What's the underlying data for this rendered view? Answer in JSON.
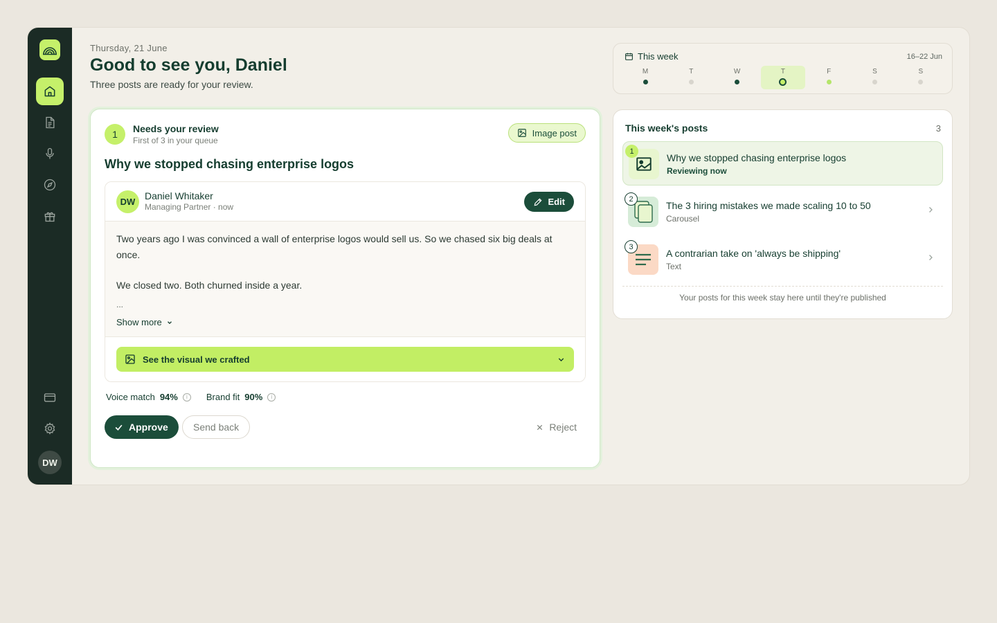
{
  "header": {
    "date": "Thursday, 21 June",
    "greeting": "Good to see you, Daniel",
    "subtitle": "Three posts are ready for your review."
  },
  "sidebar": {
    "user_initials": "DW",
    "nav": [
      "home-icon",
      "document-icon",
      "microphone-icon",
      "compass-icon",
      "gift-icon",
      "credit-card-icon",
      "gear-icon"
    ]
  },
  "week": {
    "title": "This week",
    "range": "16–22 Jun",
    "days": [
      {
        "letter": "M",
        "status": "done"
      },
      {
        "letter": "T",
        "status": "none"
      },
      {
        "letter": "W",
        "status": "done"
      },
      {
        "letter": "T",
        "status": "today"
      },
      {
        "letter": "F",
        "status": "planned"
      },
      {
        "letter": "S",
        "status": "none"
      },
      {
        "letter": "S",
        "status": "none"
      }
    ]
  },
  "review": {
    "step": "1",
    "heading": "Needs your review",
    "queue_note": "First of 3 in your queue",
    "type_label": "Image post",
    "title": "Why we stopped chasing enterprise logos",
    "author": {
      "initials": "DW",
      "name": "Daniel Whitaker",
      "meta": "Managing Partner · now"
    },
    "edit_label": "Edit",
    "body": [
      "Two years ago I was convinced a wall of enterprise logos would sell us. So we chased six big deals at once.",
      "We closed two. Both churned inside a year.",
      "..."
    ],
    "show_more": "Show more",
    "visual_label": "See the visual we crafted",
    "scores": {
      "voice_label": "Voice match",
      "voice_value": "94%",
      "brand_label": "Brand fit",
      "brand_value": "90%"
    },
    "actions": {
      "approve": "Approve",
      "send_back": "Send back",
      "reject": "Reject"
    }
  },
  "posts_panel": {
    "title": "This week's posts",
    "count": "3",
    "items": [
      {
        "num": "1",
        "title": "Why we stopped chasing enterprise logos",
        "sub": "Reviewing now",
        "type": "image"
      },
      {
        "num": "2",
        "title": "The 3 hiring mistakes we made scaling 10 to 50",
        "sub": "Carousel",
        "type": "carousel"
      },
      {
        "num": "3",
        "title": "A contrarian take on 'always be shipping'",
        "sub": "Text",
        "type": "text"
      }
    ],
    "note": "Your posts for this week stay here until they're published"
  },
  "colors": {
    "accent": "#c5f06a",
    "brand_dark": "#1b4d3a",
    "sidebar": "#1b2b25",
    "background": "#f2efe8"
  }
}
